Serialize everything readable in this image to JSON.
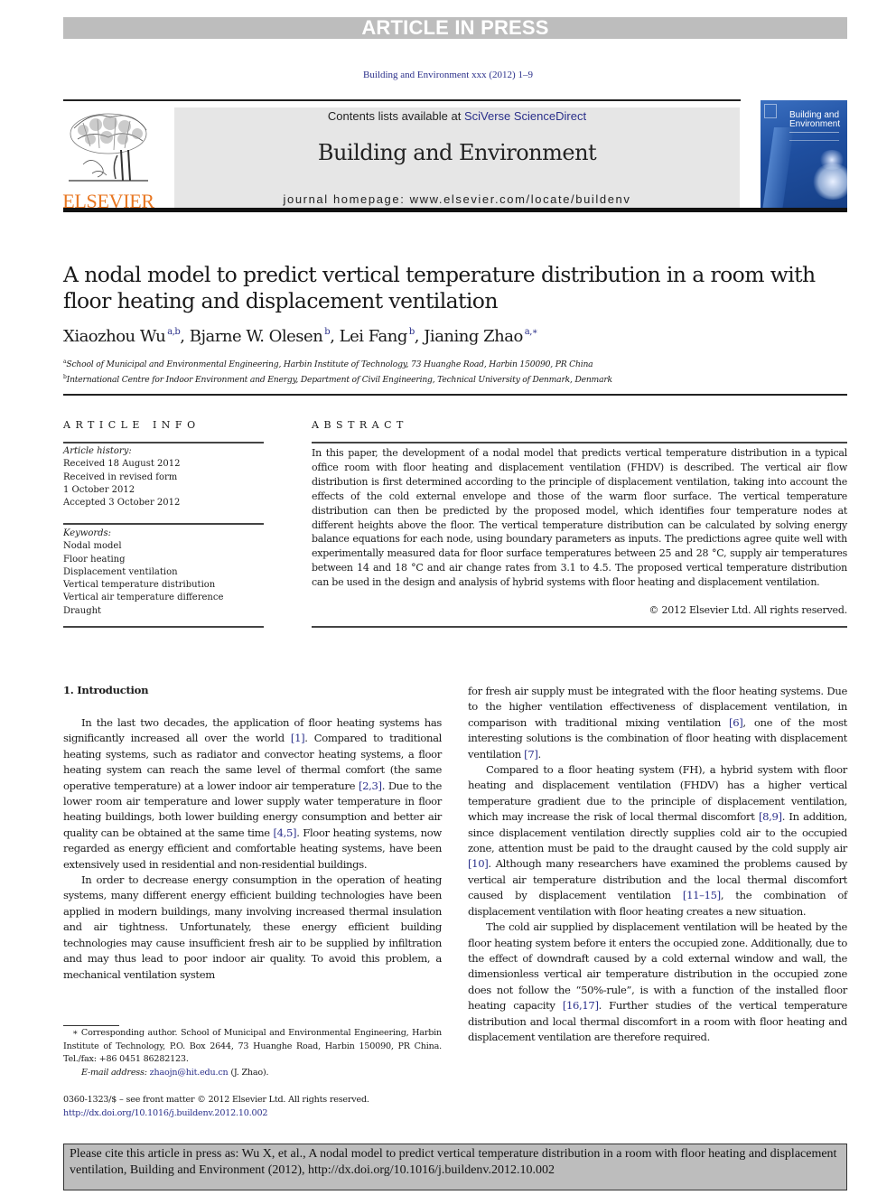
{
  "banner": {
    "text": "ARTICLE IN PRESS"
  },
  "journal_ref": "Building and Environment xxx (2012) 1–9",
  "header": {
    "publisher_logo_text": "ELSEVIER",
    "contents_prefix": "Contents lists available at ",
    "contents_link": "SciVerse ScienceDirect",
    "journal_title": "Building and Environment",
    "homepage_prefix": "journal homepage: ",
    "homepage_url": "www.elsevier.com/locate/buildenv",
    "cover_title_line1": "Building and",
    "cover_title_line2": "Environment"
  },
  "article": {
    "title": "A nodal model to predict vertical temperature distribution in a room with floor heating and displacement ventilation",
    "authors": [
      {
        "name": "Xiaozhou Wu",
        "sup": "a,b",
        "sep": ", "
      },
      {
        "name": "Bjarne W. Olesen",
        "sup": "b",
        "sep": ", "
      },
      {
        "name": "Lei Fang",
        "sup": "b",
        "sep": ", "
      },
      {
        "name": "Jianing Zhao",
        "sup": "a,∗",
        "sep": ""
      }
    ],
    "affiliations": [
      {
        "mark": "a",
        "text": "School of Municipal and Environmental Engineering, Harbin Institute of Technology, 73 Huanghe Road, Harbin 150090, PR China"
      },
      {
        "mark": "b",
        "text": "International Centre for Indoor Environment and Energy, Department of Civil Engineering, Technical University of Denmark, Denmark"
      }
    ]
  },
  "article_info": {
    "heading": "ARTICLE INFO",
    "history_label": "Article history:",
    "history": [
      "Received 18 August 2012",
      "Received in revised form",
      "1 October 2012",
      "Accepted 3 October 2012"
    ],
    "keywords_label": "Keywords:",
    "keywords": [
      "Nodal model",
      "Floor heating",
      "Displacement ventilation",
      "Vertical temperature distribution",
      "Vertical air temperature difference",
      "Draught"
    ]
  },
  "abstract": {
    "heading": "ABSTRACT",
    "text": "In this paper, the development of a nodal model that predicts vertical temperature distribution in a typical office room with floor heating and displacement ventilation (FHDV) is described. The vertical air flow distribution is first determined according to the principle of displacement ventilation, taking into account the effects of the cold external envelope and those of the warm floor surface. The vertical temperature distribution can then be predicted by the proposed model, which identifies four temperature nodes at different heights above the floor. The vertical temperature distribution can be calculated by solving energy balance equations for each node, using boundary parameters as inputs. The predictions agree quite well with experimentally measured data for floor surface temperatures between 25 and 28 °C, supply air temperatures between 14 and 18 °C and air change rates from 3.1 to 4.5. The proposed vertical temperature distribution can be used in the design and analysis of hybrid systems with floor heating and displacement ventilation.",
    "copyright": "© 2012 Elsevier Ltd. All rights reserved."
  },
  "body": {
    "section_heading": "1.  Introduction",
    "left_paragraphs": [
      [
        {
          "t": "In the last two decades, the application of floor heating systems has significantly increased all over the world "
        },
        {
          "ref": "[1]"
        },
        {
          "t": ". Compared to traditional heating systems, such as radiator and convector heating systems, a floor heating system can reach the same level of thermal comfort (the same operative temperature) at a lower indoor air temperature "
        },
        {
          "ref": "[2,3]"
        },
        {
          "t": ". Due to the lower room air temperature and lower supply water temperature in floor heating buildings, both lower building energy consumption and better air quality can be obtained at the same time "
        },
        {
          "ref": "[4,5]"
        },
        {
          "t": ". Floor heating systems, now regarded as energy efficient and comfortable heating systems, have been extensively used in residential and non-residential buildings."
        }
      ],
      [
        {
          "t": "In order to decrease energy consumption in the operation of heating systems, many different energy efficient building technologies have been applied in modern buildings, many involving increased thermal insulation and air tightness. Unfortunately, these energy efficient building technologies may cause insufficient fresh air to be supplied by infiltration and may thus lead to poor indoor air quality. To avoid this problem, a mechanical ventilation system"
        }
      ]
    ],
    "right_paragraphs": [
      [
        {
          "t": "for fresh air supply must be integrated with the floor heating systems. Due to the higher ventilation effectiveness of displacement ventilation, in comparison with traditional mixing ventilation "
        },
        {
          "ref": "[6]"
        },
        {
          "t": ", one of the most interesting solutions is the combination of floor heating with displacement ventilation "
        },
        {
          "ref": "[7]"
        },
        {
          "t": "."
        }
      ],
      [
        {
          "t": "Compared to a floor heating system (FH), a hybrid system with floor heating and displacement ventilation (FHDV) has a higher vertical temperature gradient due to the principle of displacement ventilation, which may increase the risk of local thermal discomfort "
        },
        {
          "ref": "[8,9]"
        },
        {
          "t": ". In addition, since displacement ventilation directly supplies cold air to the occupied zone, attention must be paid to the draught caused by the cold supply air "
        },
        {
          "ref": "[10]"
        },
        {
          "t": ". Although many researchers have examined the problems caused by vertical air temperature distribution and the local thermal discomfort caused by displacement ventilation "
        },
        {
          "ref": "[11–15]"
        },
        {
          "t": ", the combination of displacement ventilation with floor heating creates a new situation."
        }
      ],
      [
        {
          "t": "The cold air supplied by displacement ventilation will be heated by the floor heating system before it enters the occupied zone. Additionally, due to the effect of downdraft caused by a cold external window and wall, the dimensionless vertical air temperature distribution in the occupied zone does not follow the “50%-rule”, is with a function of the installed floor heating capacity "
        },
        {
          "ref": "[16,17]"
        },
        {
          "t": ". Further studies of the vertical temperature distribution and local thermal discomfort in a room with floor heating and displacement ventilation are therefore required."
        }
      ]
    ]
  },
  "footnote": {
    "corresponding": "∗ Corresponding author. School of Municipal and Environmental Engineering, Harbin Institute of Technology, P.O. Box 2644, 73 Huanghe Road, Harbin 150090, PR China. Tel./fax: +86 0451 86282123.",
    "email_label": "E-mail address:",
    "email": "zhaojn@hit.edu.cn",
    "email_suffix": " (J. Zhao).",
    "front_matter": "0360-1323/$ – see front matter © 2012 Elsevier Ltd. All rights reserved.",
    "doi": "http://dx.doi.org/10.1016/j.buildenv.2012.10.002"
  },
  "cite_box": {
    "text": "Please cite this article in press as: Wu X, et al., A nodal model to predict vertical temperature distribution in a room with floor heating and displacement ventilation, Building and Environment (2012), http://dx.doi.org/10.1016/j.buildenv.2012.10.002"
  },
  "colors": {
    "link": "#2a2f8a",
    "elsevier_orange": "#e87722",
    "banner_gray": "#bdbdbd",
    "masthead_gray": "#e6e6e6"
  }
}
